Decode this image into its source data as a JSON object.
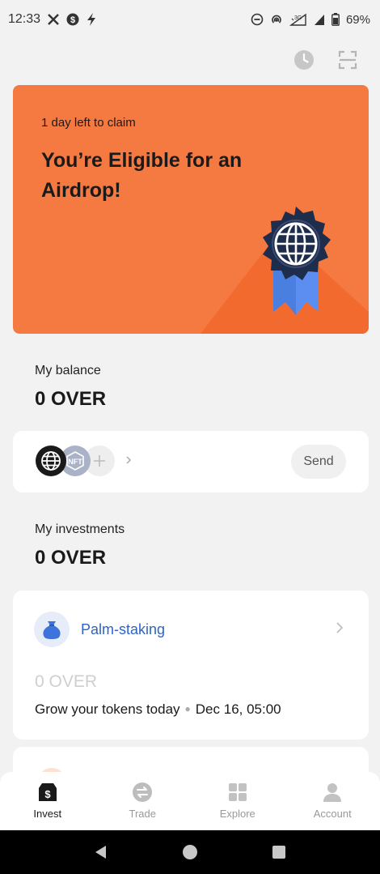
{
  "status_bar": {
    "time": "12:33",
    "battery": "69%",
    "left_icons": [
      "x-logo-icon",
      "dollar-circle-icon",
      "lightning-icon"
    ],
    "right_icons": [
      "do-not-disturb-icon",
      "hotspot-icon",
      "network-3g-icon",
      "signal-icon",
      "battery-icon"
    ]
  },
  "header": {
    "actions": [
      "history-clock-icon",
      "scan-icon"
    ]
  },
  "banner": {
    "claim_text": "1 day left to claim",
    "headline": "You’re Eligible for an Airdrop!",
    "background": "#f47a42",
    "badge_icon": "globe-award-badge-icon"
  },
  "balance": {
    "label": "My balance",
    "value": "0 OVER"
  },
  "assets": {
    "coins": [
      "globe-coin-icon",
      "nft-coin-icon",
      "add-coin-icon"
    ],
    "send_label": "Send"
  },
  "investments": {
    "label": "My investments",
    "value": "0 OVER",
    "card": {
      "title": "Palm-staking",
      "amount": "0 OVER",
      "description": "Grow your tokens today",
      "date": "Dec 16, 05:00",
      "icon": "money-bag-icon"
    }
  },
  "bottom_nav": {
    "items": [
      {
        "label": "Invest",
        "icon": "invest-icon",
        "active": true
      },
      {
        "label": "Trade",
        "icon": "trade-icon",
        "active": false
      },
      {
        "label": "Explore",
        "icon": "explore-grid-icon",
        "active": false
      },
      {
        "label": "Account",
        "icon": "account-icon",
        "active": false
      }
    ]
  },
  "colors": {
    "accent_orange": "#f47a42",
    "link_blue": "#2e63c9",
    "badge_navy": "#1f2d4d",
    "ribbon_blue": "#4a7fe0"
  }
}
